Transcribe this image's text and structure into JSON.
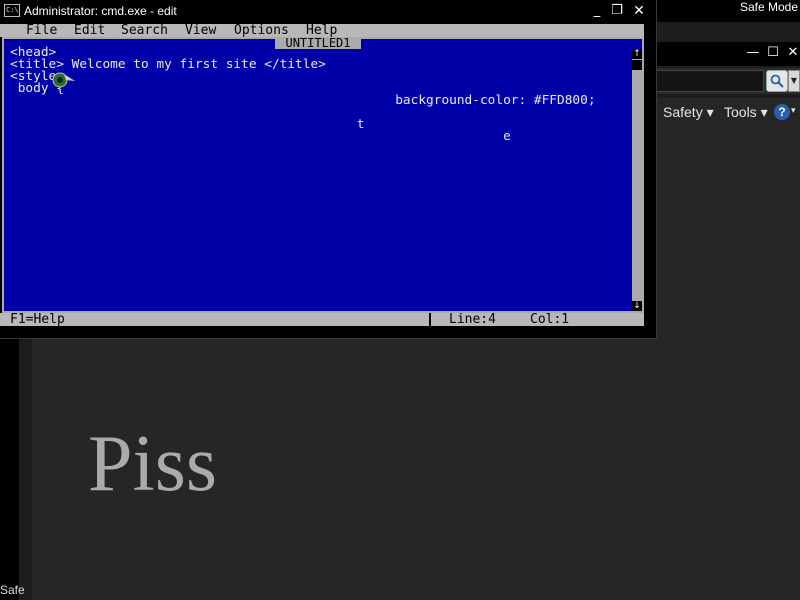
{
  "background_window": {
    "title_right": "Safe Mode",
    "caption_buttons": {
      "minimize": "—",
      "maximize": "☐",
      "close": "✕"
    },
    "command_bar": {
      "safety": "Safety ▾",
      "tools": "Tools ▾",
      "help": "?",
      "help_arrow": "▾"
    },
    "page_heading": "Piss",
    "status_left": "Safe"
  },
  "cmd_window": {
    "title": "Administrator: cmd.exe - edit",
    "icon_text": "C:\\",
    "buttons": {
      "minimize": "_",
      "restore": "❐",
      "close": "✕"
    },
    "editor": {
      "menu": [
        "File",
        "Edit",
        "Search",
        "View",
        "Options",
        "Help"
      ],
      "document_title": "UNTITLED1",
      "lines": [
        "<head>",
        "<title> Welcome to my first site </title>",
        "<style>",
        " body {",
        "                                                  background-color: #FFD800;",
        "",
        "                                             t",
        "",
        "                                                                e"
      ],
      "status": {
        "help": "F1=Help",
        "line": "Line:4",
        "col": "Col:1"
      },
      "scroll_up": "↑",
      "scroll_down": "↓"
    }
  },
  "colors": {
    "editor_background": "#0000A8",
    "editor_text": "#EAEAEA",
    "menu_bar": "#B8B8B8"
  }
}
